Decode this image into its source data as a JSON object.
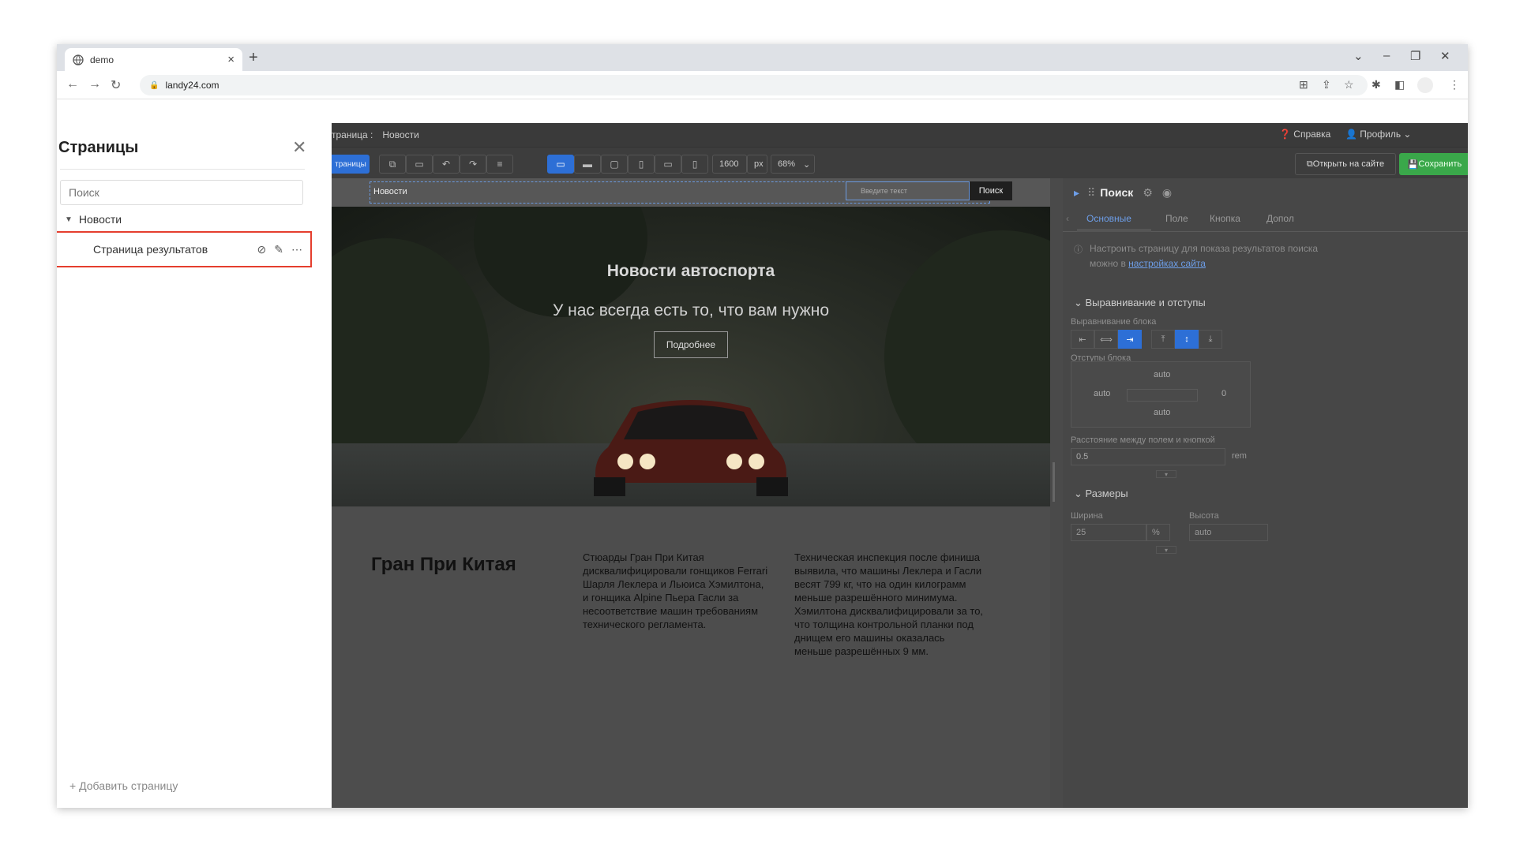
{
  "browser": {
    "tab_title": "demo",
    "new_tab": "+",
    "tab_close": "×",
    "url": "landy24.com"
  },
  "sidebar": {
    "title": "Страницы",
    "search_placeholder": "Поиск",
    "tree": {
      "parent_label": "Новости",
      "child_label": "Страница результатов"
    },
    "add_page": "+ Добавить страницу"
  },
  "editor": {
    "breadcrumb_prefix": "траница :",
    "breadcrumb_current": "Новости",
    "help": "Справка",
    "profile": "Профиль",
    "toolbar": {
      "pages_label": "траницы",
      "width_value": "1600",
      "width_unit": "px",
      "zoom_value": "68%",
      "open_site": "Открыть на сайте",
      "save": "Сохранить"
    }
  },
  "canvas": {
    "search_block": {
      "label": "Новости",
      "input_placeholder": "Введите текст",
      "button": "Поиск"
    },
    "hero": {
      "title": "Новости автоспорта",
      "subtitle": "У нас всегда есть то, что вам нужно",
      "button": "Подробнее"
    },
    "article": {
      "title": "Гран При Китая",
      "col1": "Стюарды Гран При Китая дисквалифицировали гонщиков Ferrari Шарля Леклера и Льюиса Хэмилтона, и гонщика Alpine Пьера Гасли за несоответствие машин требованиям технического регламента.",
      "col2": "Техническая инспекция после финиша выявила, что машины Леклера и Гасли весят 799 кг, что на один килограмм меньше разрешённого минимума. Хэмилтона дисквалифицировали за то, что толщина контрольной планки под днищем его машины оказалась меньше разрешённых 9 мм."
    }
  },
  "panel": {
    "title": "Поиск",
    "tabs": [
      "Основные",
      "Поле",
      "Кнопка",
      "Допол"
    ],
    "note_text": "Настроить страницу для показа результатов поиска можно в ",
    "note_link": "настройках сайта",
    "section_alignment": "Выравнивание и отступы",
    "block_alignment_label": "Выравнивание блока",
    "block_padding_label": "Отступы блока",
    "padding": {
      "top": "auto",
      "left": "auto",
      "right": "0",
      "bottom": "auto"
    },
    "gap_label": "Расстояние между полем и кнопкой",
    "gap_value": "0.5",
    "gap_unit": "rem",
    "section_sizes": "Размеры",
    "width_label": "Ширина",
    "width_value": "25",
    "width_unit": "%",
    "height_label": "Высота",
    "height_value": "auto"
  },
  "colors": {
    "accent": "#2d6fd6",
    "highlight": "#e53e2e",
    "save": "#3aa84a"
  }
}
